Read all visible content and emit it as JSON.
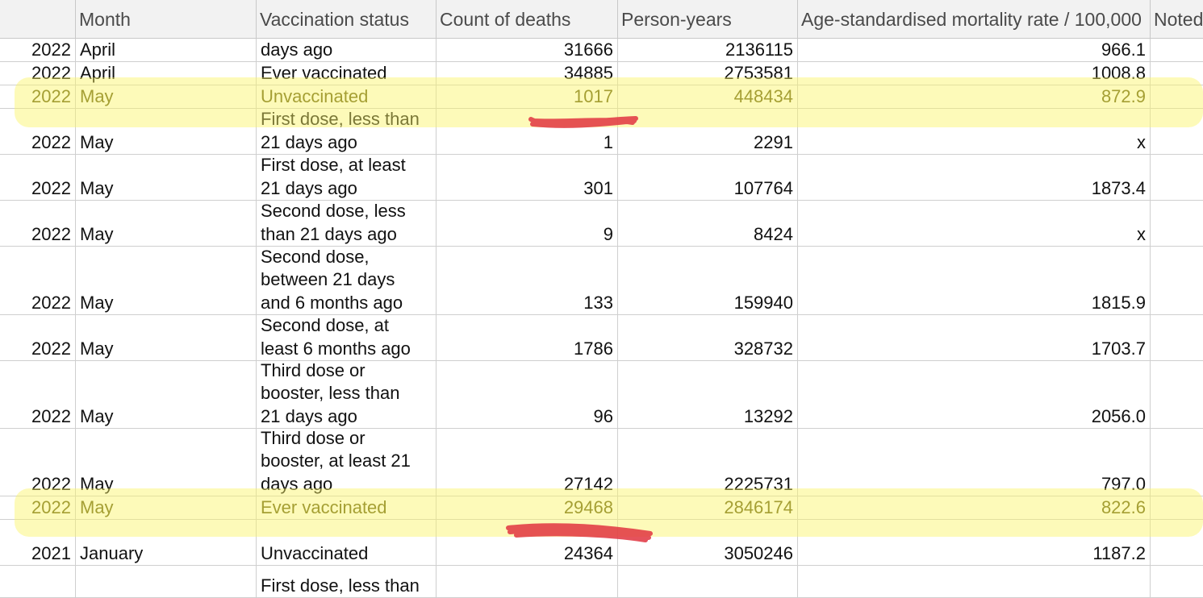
{
  "headers": [
    "",
    "Month",
    "Vaccination status",
    "Count of deaths",
    "Person-years",
    "Age-standardised mortality rate / 100,000",
    "Noted"
  ],
  "rows": [
    {
      "year": "2022",
      "month": "April",
      "status": "days ago",
      "deaths": "31666",
      "person_years": "2136115",
      "rate": "966.1",
      "highlighted": false
    },
    {
      "year": "2022",
      "month": "April",
      "status": "Ever vaccinated",
      "deaths": "34885",
      "person_years": "2753581",
      "rate": "1008.8",
      "highlighted": false
    },
    {
      "year": "2022",
      "month": "May",
      "status": "Unvaccinated",
      "deaths": "1017",
      "person_years": "448434",
      "rate": "872.9",
      "highlighted": true
    },
    {
      "year": "2022",
      "month": "May",
      "status": "First dose, less than\n21 days ago",
      "deaths": "1",
      "person_years": "2291",
      "rate": "x",
      "highlighted": false
    },
    {
      "year": "2022",
      "month": "May",
      "status": "First dose, at least\n21 days ago",
      "deaths": "301",
      "person_years": "107764",
      "rate": "1873.4",
      "highlighted": false
    },
    {
      "year": "2022",
      "month": "May",
      "status": "Second dose, less\nthan 21 days ago",
      "deaths": "9",
      "person_years": "8424",
      "rate": "x",
      "highlighted": false
    },
    {
      "year": "2022",
      "month": "May",
      "status": "Second dose,\nbetween 21 days\nand 6 months ago",
      "deaths": "133",
      "person_years": "159940",
      "rate": "1815.9",
      "highlighted": false
    },
    {
      "year": "2022",
      "month": "May",
      "status": "Second dose, at\nleast 6 months ago",
      "deaths": "1786",
      "person_years": "328732",
      "rate": "1703.7",
      "highlighted": false
    },
    {
      "year": "2022",
      "month": "May",
      "status": "Third dose or\nbooster, less than\n21 days ago",
      "deaths": "96",
      "person_years": "13292",
      "rate": "2056.0",
      "highlighted": false
    },
    {
      "year": "2022",
      "month": "May",
      "status": "Third dose or\nbooster, at least 21\ndays ago",
      "deaths": "27142",
      "person_years": "2225731",
      "rate": "797.0",
      "highlighted": false
    },
    {
      "year": "2022",
      "month": "May",
      "status": "Ever vaccinated",
      "deaths": "29468",
      "person_years": "2846174",
      "rate": "822.6",
      "highlighted": true
    },
    {
      "year": "2021",
      "month": "January",
      "status": "Unvaccinated",
      "deaths": "24364",
      "person_years": "3050246",
      "rate": "1187.2",
      "highlighted": false
    },
    {
      "year": "",
      "month": "",
      "status": "First dose, less than",
      "deaths": "",
      "person_years": "",
      "rate": "",
      "highlighted": false
    }
  ],
  "colors": {
    "highlight": "#f7f06a",
    "scribble": "#e0343f",
    "header_bg": "#f2f2f2",
    "grid": "#cfcfcf"
  }
}
